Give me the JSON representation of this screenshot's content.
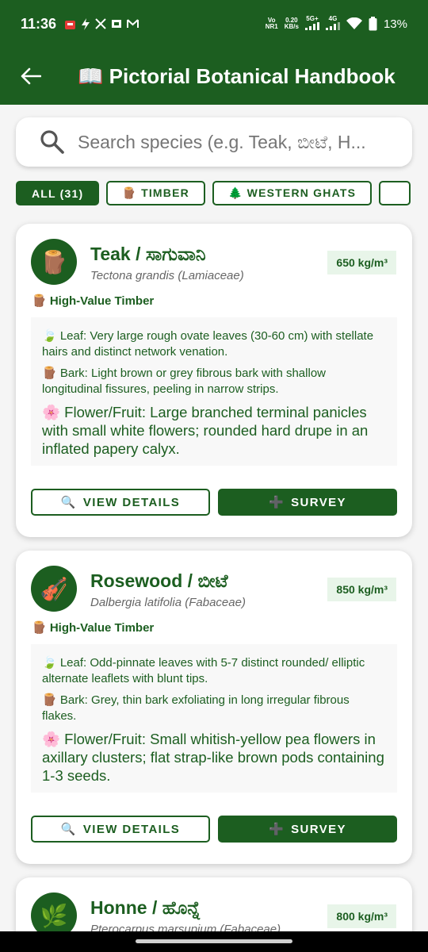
{
  "status_bar": {
    "time": "11:36",
    "network_top": "Vo",
    "network_bottom": "NR1",
    "speed_top": "0.20",
    "speed_bottom": "KB/s",
    "gen_5g": "5G+",
    "gen_4g": "4G",
    "battery": "13%"
  },
  "app_bar": {
    "title": "📖 Pictorial Botanical Handbook",
    "back_icon": "arrow-left-icon"
  },
  "search": {
    "placeholder": "Search species (e.g. Teak, ಬೀಟೆ, H..."
  },
  "chips": [
    {
      "label": "ALL (31)",
      "active": true
    },
    {
      "label": "🪵 TIMBER",
      "active": false
    },
    {
      "label": "🌲 WESTERN GHATS",
      "active": false
    },
    {
      "label": "",
      "active": false
    }
  ],
  "species": [
    {
      "emoji": "🪵",
      "name": "Teak / ಸಾಗುವಾನಿ",
      "scientific": "Tectona grandis (Lamiaceae)",
      "density": "650 kg/m³",
      "tag": "🪵 High-Value Timber",
      "leaf": "🍃 Leaf: Very large rough ovate leaves (30-60 cm) with stellate hairs and distinct network venation.",
      "bark": "🪵 Bark: Light brown or grey fibrous bark with shallow longitudinal fissures, peeling in narrow strips.",
      "flower": "🌸 Flower/Fruit: Large branched terminal panicles with small white flowers; rounded hard drupe in an inflated papery calyx."
    },
    {
      "emoji": "🎻",
      "name": "Rosewood / ಬೀಟೆ",
      "scientific": "Dalbergia latifolia (Fabaceae)",
      "density": "850 kg/m³",
      "tag": "🪵 High-Value Timber",
      "leaf": "🍃 Leaf: Odd-pinnate leaves with 5-7 distinct rounded/ elliptic alternate leaflets with blunt tips.",
      "bark": "🪵 Bark: Grey, thin bark exfoliating in long irregular fibrous flakes.",
      "flower": "🌸 Flower/Fruit: Small whitish-yellow pea flowers in axillary clusters; flat strap-like brown pods containing 1-3 seeds."
    },
    {
      "emoji": "🌿",
      "name": "Honne / ಹೊನ್ನೆ",
      "scientific": "Pterocarpus marsupium (Fabaceae)",
      "density": "800 kg/m³"
    }
  ],
  "buttons": {
    "details_label": "VIEW DETAILS",
    "details_icon": "magnifier-icon",
    "survey_label": "SURVEY",
    "survey_icon": "plus-icon",
    "details_glyph": "🔍",
    "survey_glyph": "➕"
  },
  "colors": {
    "primary": "#1c5e20",
    "badge_bg": "#e8f5e9",
    "background": "#f5f5f5"
  }
}
